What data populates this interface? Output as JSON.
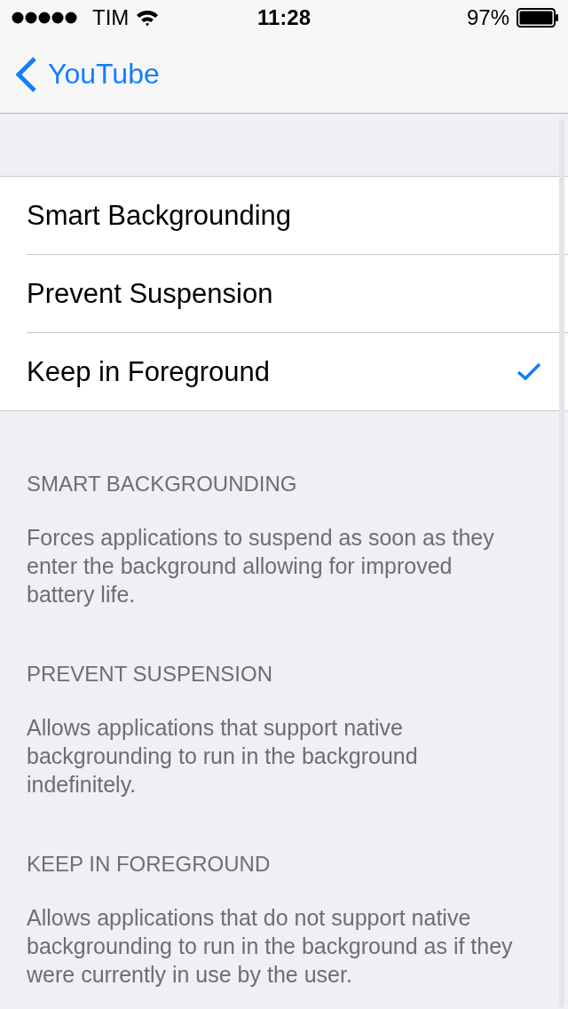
{
  "status_bar": {
    "carrier": "TIM",
    "time": "11:28",
    "battery": "97%"
  },
  "nav": {
    "back": "YouTube"
  },
  "options": [
    {
      "label": "Smart Backgrounding",
      "selected": false
    },
    {
      "label": "Prevent Suspension",
      "selected": false
    },
    {
      "label": "Keep in Foreground",
      "selected": true
    }
  ],
  "sections": [
    {
      "header": "SMART BACKGROUNDING",
      "text": "Forces applications to suspend as soon as they enter the background allowing for improved battery life."
    },
    {
      "header": "PREVENT SUSPENSION",
      "text": "Allows applications that support native backgrounding to run in the background indefinitely."
    },
    {
      "header": "KEEP IN FOREGROUND",
      "text": "Allows applications that do not support native backgrounding to run in the background as if they were currently in use by the user."
    }
  ]
}
